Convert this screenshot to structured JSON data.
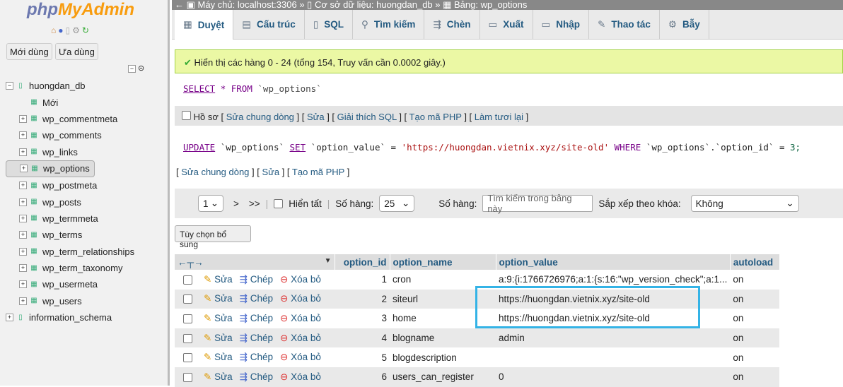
{
  "sidebar": {
    "logo_a": "php",
    "logo_b": "MyAdmin",
    "recent": "Mới dùng",
    "favorites": "Ưa dùng",
    "tree": [
      {
        "label": "huongdan_db",
        "level": 0,
        "exp": "−"
      },
      {
        "label": "Mới",
        "level": 1,
        "exp": ""
      },
      {
        "label": "wp_commentmeta",
        "level": 1,
        "exp": "+"
      },
      {
        "label": "wp_comments",
        "level": 1,
        "exp": "+"
      },
      {
        "label": "wp_links",
        "level": 1,
        "exp": "+"
      },
      {
        "label": "wp_options",
        "level": 1,
        "exp": "+",
        "selected": true
      },
      {
        "label": "wp_postmeta",
        "level": 1,
        "exp": "+"
      },
      {
        "label": "wp_posts",
        "level": 1,
        "exp": "+"
      },
      {
        "label": "wp_termmeta",
        "level": 1,
        "exp": "+"
      },
      {
        "label": "wp_terms",
        "level": 1,
        "exp": "+"
      },
      {
        "label": "wp_term_relationships",
        "level": 1,
        "exp": "+"
      },
      {
        "label": "wp_term_taxonomy",
        "level": 1,
        "exp": "+"
      },
      {
        "label": "wp_usermeta",
        "level": 1,
        "exp": "+"
      },
      {
        "label": "wp_users",
        "level": 1,
        "exp": "+"
      },
      {
        "label": "information_schema",
        "level": 0,
        "exp": "+"
      }
    ]
  },
  "breadcrumb": {
    "server": "Máy chủ: localhost:3306",
    "db": "Cơ sở dữ liệu: huongdan_db",
    "table": "Bảng: wp_options"
  },
  "tabs": [
    {
      "label": "Duyệt",
      "icon": "▦"
    },
    {
      "label": "Cấu trúc",
      "icon": "▤"
    },
    {
      "label": "SQL",
      "icon": "▯"
    },
    {
      "label": "Tìm kiếm",
      "icon": "⚲"
    },
    {
      "label": "Chèn",
      "icon": "⇶"
    },
    {
      "label": "Xuất",
      "icon": "▭"
    },
    {
      "label": "Nhập",
      "icon": "▭"
    },
    {
      "label": "Thao tác",
      "icon": "✎"
    },
    {
      "label": "Bẫy",
      "icon": "⚙"
    }
  ],
  "success": "Hiển thị các hàng 0 - 24 (tổng 154, Truy vấn cần 0.0002 giây.)",
  "query": {
    "select": "SELECT",
    "star": "*",
    "from": "FROM",
    "table": "`wp_options`"
  },
  "query_tools": {
    "profile": "Hồ sơ",
    "l1": "Sửa chung dòng",
    "l2": "Sửa",
    "l3": "Giải thích SQL",
    "l4": "Tạo mã PHP",
    "l5": "Làm tươi lại"
  },
  "update": {
    "kw1": "UPDATE",
    "t": "`wp_options`",
    "kw2": "SET",
    "col": "`option_value`",
    "eq": "=",
    "val": "'https://huongdan.vietnix.xyz/site-old'",
    "kw3": "WHERE",
    "t2": "`wp_options`.`option_id`",
    "eq2": "=",
    "n": "3;"
  },
  "update_tools": {
    "l1": "Sửa chung dòng",
    "l2": "Sửa",
    "l3": "Tạo mã PHP"
  },
  "nav": {
    "page": "1",
    "next": ">",
    "last": ">>",
    "show_all": "Hiển tất",
    "rows_label": "Số hàng:",
    "rows": "25",
    "filter_label": "Số hàng:",
    "filter_placeholder": "Tìm kiếm trong bảng này",
    "sort_label": "Sắp xếp theo khóa:",
    "sort": "Không"
  },
  "extra_options": "Tùy chọn bổ sung",
  "table": {
    "headers": [
      "option_id",
      "option_name",
      "option_value",
      "autoload"
    ],
    "actions": {
      "edit": "Sửa",
      "copy": "Chép",
      "delete": "Xóa bỏ"
    },
    "rows": [
      [
        "1",
        "cron",
        "a:9:{i:1766726976;a:1:{s:16:\"wp_version_check\";a:1...",
        "on"
      ],
      [
        "2",
        "siteurl",
        "https://huongdan.vietnix.xyz/site-old",
        "on"
      ],
      [
        "3",
        "home",
        "https://huongdan.vietnix.xyz/site-old",
        "on"
      ],
      [
        "4",
        "blogname",
        "admin",
        "on"
      ],
      [
        "5",
        "blogdescription",
        "",
        "on"
      ],
      [
        "6",
        "users_can_register",
        "0",
        "on"
      ]
    ]
  }
}
